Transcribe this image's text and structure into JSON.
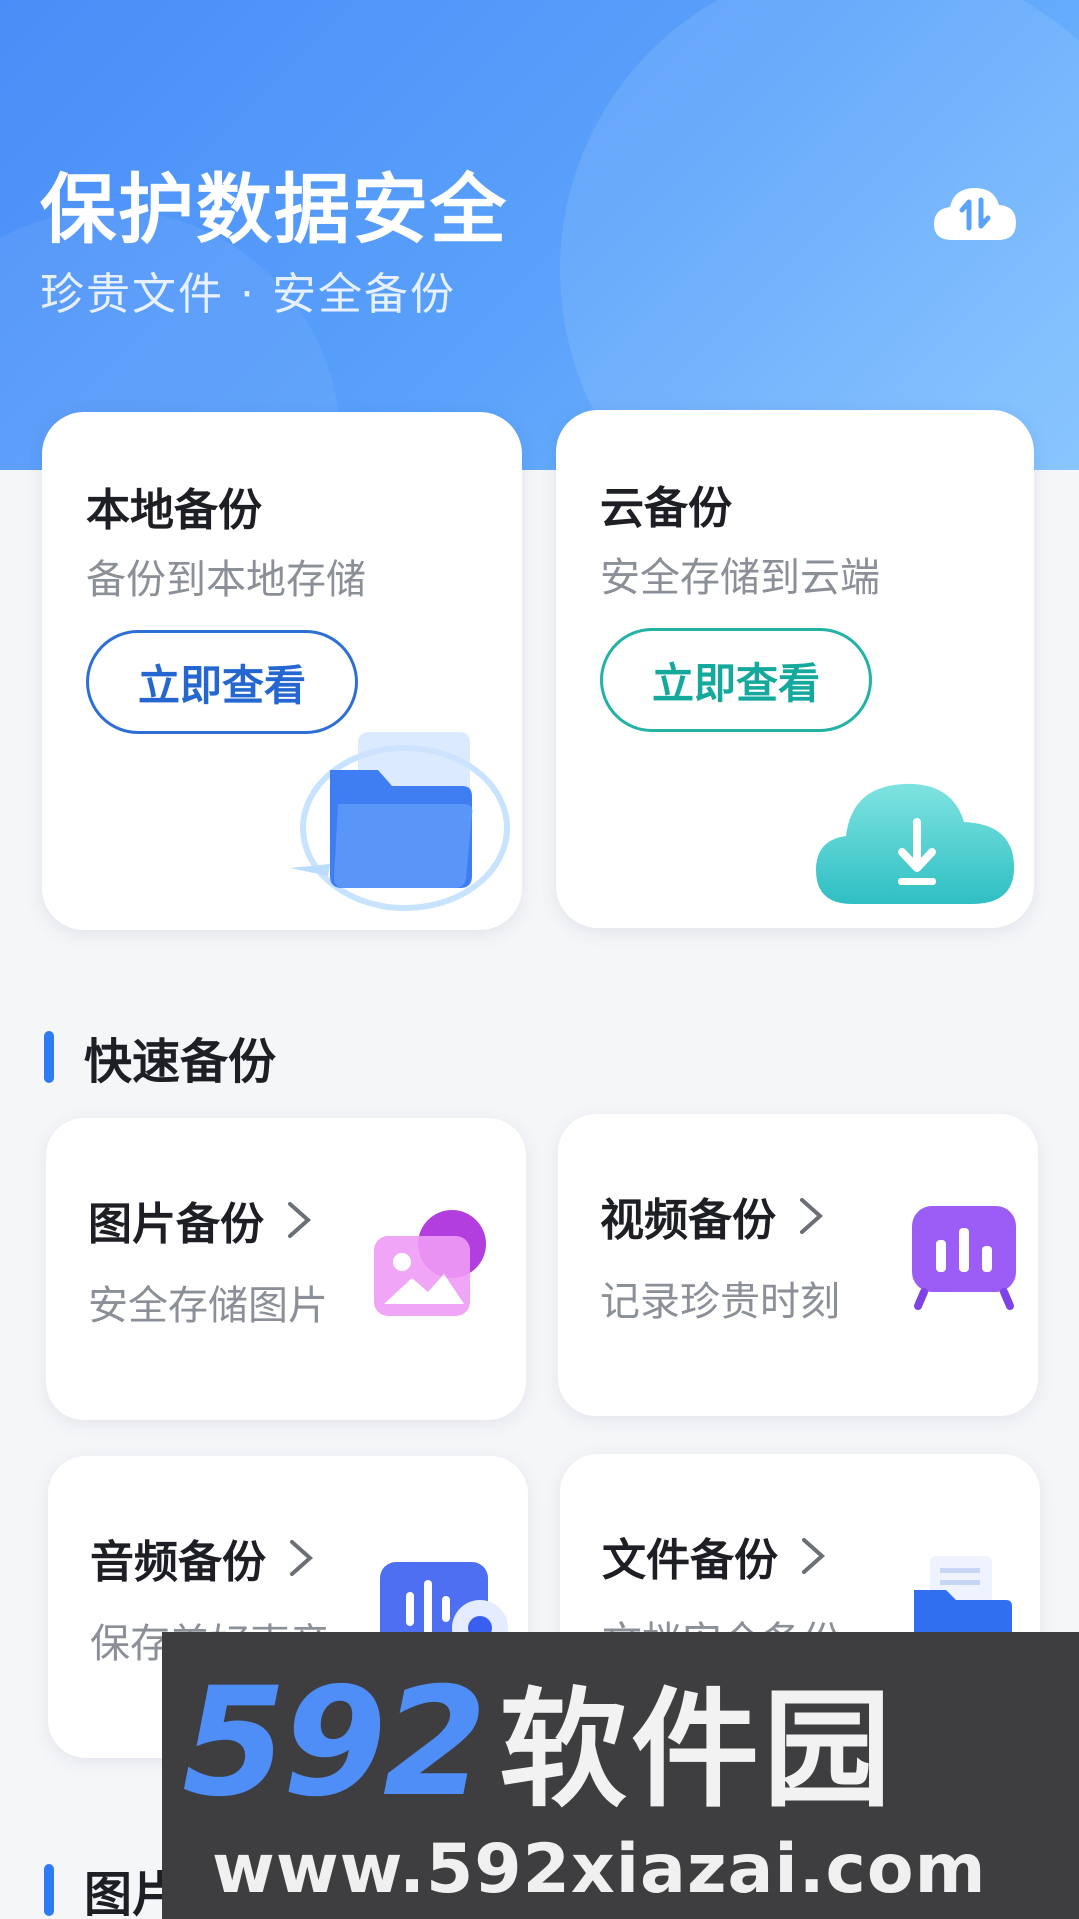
{
  "header": {
    "title": "保护数据安全",
    "subtitle": "珍贵文件 · 安全备份",
    "sync_icon": "cloud-sync-icon"
  },
  "primary_cards": [
    {
      "title": "本地备份",
      "desc": "备份到本地存储",
      "button": "立即查看",
      "icon": "folder-icon",
      "accent": "#2567d0"
    },
    {
      "title": "云备份",
      "desc": "安全存储到云端",
      "button": "立即查看",
      "icon": "cloud-download-icon",
      "accent": "#15a89c"
    }
  ],
  "sections": [
    {
      "title": "快速备份"
    },
    {
      "title": "图片"
    }
  ],
  "quick_items": [
    {
      "title": "图片备份",
      "desc": "安全存储图片",
      "icon": "image-icon"
    },
    {
      "title": "视频备份",
      "desc": "记录珍贵时刻",
      "icon": "video-icon"
    },
    {
      "title": "音频备份",
      "desc": "保存美好声音",
      "icon": "audio-icon"
    },
    {
      "title": "文件备份",
      "desc": "文档安全备份",
      "icon": "file-folder-icon"
    }
  ],
  "watermark": {
    "brand_number": "592",
    "brand_text": "软件园",
    "url": "www.592xiazai.com"
  },
  "colors": {
    "header_gradient_start": "#4a8df8",
    "header_gradient_end": "#7cc0ff",
    "section_bar": "#2e7bf6"
  }
}
